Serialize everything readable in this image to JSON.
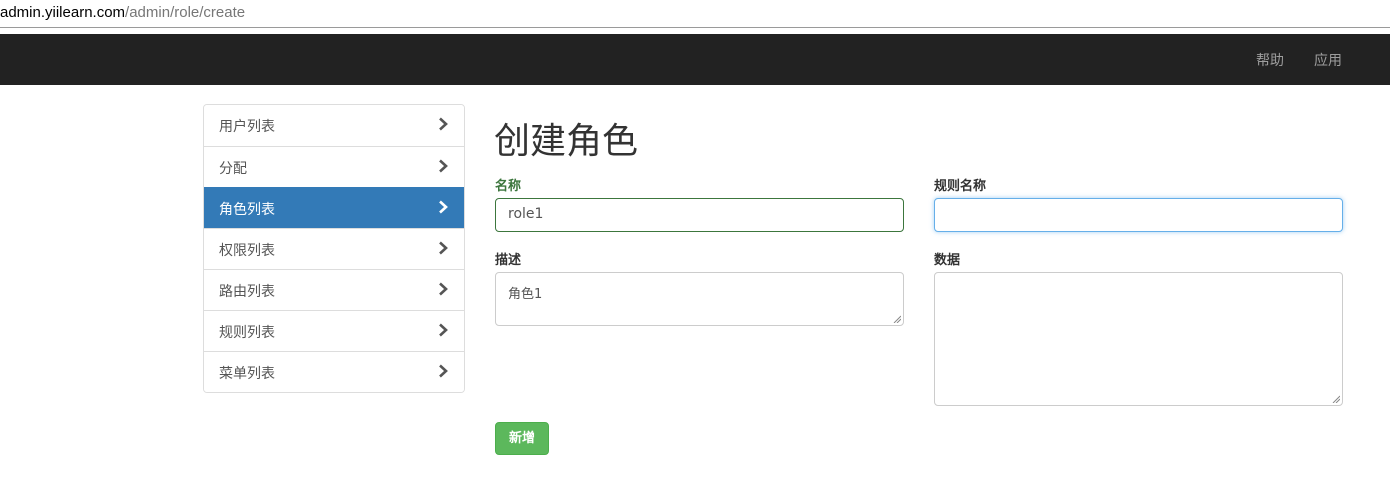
{
  "browser": {
    "url_host": "admin.yiilearn.com",
    "url_path": "/admin/role/create"
  },
  "navbar": {
    "help": "帮助",
    "apps": "应用"
  },
  "sidebar": {
    "items": [
      {
        "label": "用户列表"
      },
      {
        "label": "分配"
      },
      {
        "label": "角色列表"
      },
      {
        "label": "权限列表"
      },
      {
        "label": "路由列表"
      },
      {
        "label": "规则列表"
      },
      {
        "label": "菜单列表"
      }
    ],
    "active_index": 2
  },
  "page": {
    "title": "创建角色"
  },
  "form": {
    "name": {
      "label": "名称",
      "value": "role1"
    },
    "rule_name": {
      "label": "规则名称",
      "value": ""
    },
    "description": {
      "label": "描述",
      "value": "角色1"
    },
    "data": {
      "label": "数据",
      "value": ""
    },
    "submit_label": "新增"
  },
  "colors": {
    "navbar": "#222222",
    "active": "#337ab7",
    "success": "#3c763d",
    "button": "#5cb85c"
  }
}
